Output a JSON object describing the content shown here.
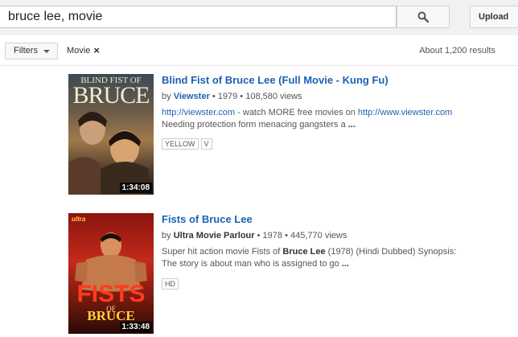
{
  "search": {
    "query": "bruce lee, movie"
  },
  "header": {
    "upload_label": "Upload"
  },
  "filters": {
    "button_label": "Filters",
    "active_filter": "Movie",
    "result_count": "About 1,200 results"
  },
  "results": [
    {
      "title": "Blind Fist of Bruce Lee (Full Movie - Kung Fu)",
      "by_label": "by",
      "channel": "Viewster",
      "year": "1979",
      "views": "108,580 views",
      "desc_link1": "http://viewster.com",
      "desc_mid": " - watch MORE free movies on ",
      "desc_link2": "http://www.viewster.com",
      "desc_line2": "Needing protection form menacing gangsters a",
      "ellipsis": "...",
      "badges": [
        "YELLOW",
        "V"
      ],
      "duration": "1:34:08",
      "thumb_text_top": "BLIND FIST OF",
      "thumb_text_main": "BRUCE"
    },
    {
      "title": "Fists of Bruce Lee",
      "by_label": "by",
      "channel": "Ultra Movie Parlour",
      "year": "1978",
      "views": "445,770 views",
      "desc_a": "Super hit action movie Fists of ",
      "desc_bold": "Bruce Lee",
      "desc_b": " (1978) (Hindi Dubbed) Synopsis:",
      "desc_line2": "The story is about man who is assigned to go",
      "ellipsis": "...",
      "badges": [
        "HD"
      ],
      "duration": "1:33:48",
      "thumb_text_top": "ultra",
      "thumb_text_main": "FISTS",
      "thumb_text_of": "OF",
      "thumb_text_bottom": "BRUCE"
    }
  ],
  "colors": {
    "link": "#1b62b4",
    "background": "#f1f1f1",
    "card": "#ffffff"
  }
}
